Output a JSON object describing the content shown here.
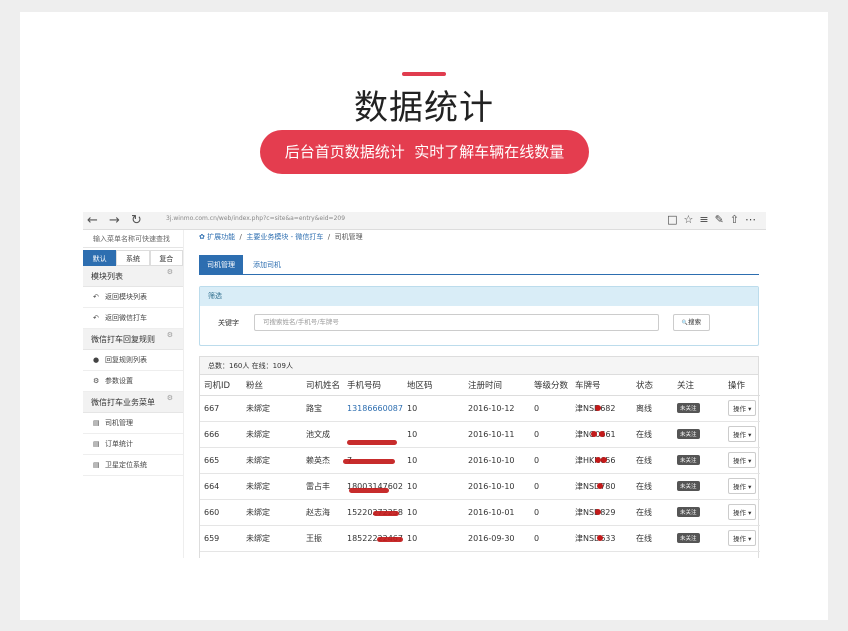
{
  "heading": "数据统计",
  "subtitle": "后台首页数据统计  实时了解车辆在线数量",
  "browser": {
    "url": "3j.winmo.com.cn/web/index.php?c=site&a=entry&eid=209",
    "nav": {
      "back": "←",
      "forward": "→",
      "reload": "↻"
    },
    "icons": [
      "□",
      "☆",
      "≡",
      "✎",
      "⇧",
      "⋯"
    ]
  },
  "sidebar": {
    "search_placeholder": "输入菜单名称可快速查找",
    "tabs": [
      "默认",
      "系统",
      "复合"
    ],
    "sections": [
      {
        "title": "模块列表",
        "items": [
          {
            "icon": "↶",
            "label": "返回模块列表"
          },
          {
            "icon": "↶",
            "label": "返回微信打车"
          }
        ]
      },
      {
        "title": "微信打车回复规则",
        "items": [
          {
            "icon": "●",
            "label": "回复规则列表"
          },
          {
            "icon": "⚙",
            "label": "参数设置"
          }
        ]
      },
      {
        "title": "微信打车业务菜单",
        "items": [
          {
            "icon": "▤",
            "label": "司机管理"
          },
          {
            "icon": "▤",
            "label": "订单统计"
          },
          {
            "icon": "▤",
            "label": "卫星定位系统"
          }
        ]
      }
    ]
  },
  "breadcrumb": {
    "icon": "✿",
    "items": [
      "扩展功能",
      "主要业务模块 - 微信打车",
      "司机管理"
    ]
  },
  "tabs": [
    "司机管理",
    "添加司机"
  ],
  "filter": {
    "title": "筛选",
    "label": "关键字",
    "placeholder": "可搜索姓名/手机号/车牌号",
    "button": "搜索",
    "button_icon": "🔍"
  },
  "summary": "总数：160人 在线：109人",
  "table": {
    "headers": [
      "司机ID",
      "粉丝",
      "司机姓名",
      "手机号码",
      "地区码",
      "注册时间",
      "等级分数",
      "车牌号",
      "状态",
      "关注",
      "操作"
    ],
    "rows": [
      {
        "id": "667",
        "fan": "未绑定",
        "name": "路宝",
        "phone": "13186660087",
        "area": "10",
        "date": "2016-10-12",
        "score": "0",
        "plate": "津NSD682",
        "status": "离线",
        "follow": "未关注",
        "op": "操作"
      },
      {
        "id": "666",
        "fan": "未绑定",
        "name": "池文成",
        "phone": "",
        "area": "10",
        "date": "2016-10-11",
        "score": "0",
        "plate": "津NO0661",
        "status": "在线",
        "follow": "未关注",
        "op": "操作"
      },
      {
        "id": "665",
        "fan": "未绑定",
        "name": "赖英杰",
        "phone": "7",
        "area": "10",
        "date": "2016-10-10",
        "score": "0",
        "plate": "津HKN656",
        "status": "在线",
        "follow": "未关注",
        "op": "操作"
      },
      {
        "id": "664",
        "fan": "未绑定",
        "name": "雷占丰",
        "phone": "18003147602",
        "area": "10",
        "date": "2016-10-10",
        "score": "0",
        "plate": "津NSD780",
        "status": "在线",
        "follow": "未关注",
        "op": "操作"
      },
      {
        "id": "660",
        "fan": "未绑定",
        "name": "赵志海",
        "phone": "15220272258",
        "area": "10",
        "date": "2016-10-01",
        "score": "0",
        "plate": "津NSD829",
        "status": "在线",
        "follow": "未关注",
        "op": "操作"
      },
      {
        "id": "659",
        "fan": "未绑定",
        "name": "王振",
        "phone": "18522222467",
        "area": "10",
        "date": "2016-09-30",
        "score": "0",
        "plate": "津NSD633",
        "status": "在线",
        "follow": "未关注",
        "op": "操作"
      }
    ]
  },
  "colors": {
    "accent": "#e43d4f",
    "primary": "#2d6eb0",
    "redaction": "#c21a1a"
  }
}
